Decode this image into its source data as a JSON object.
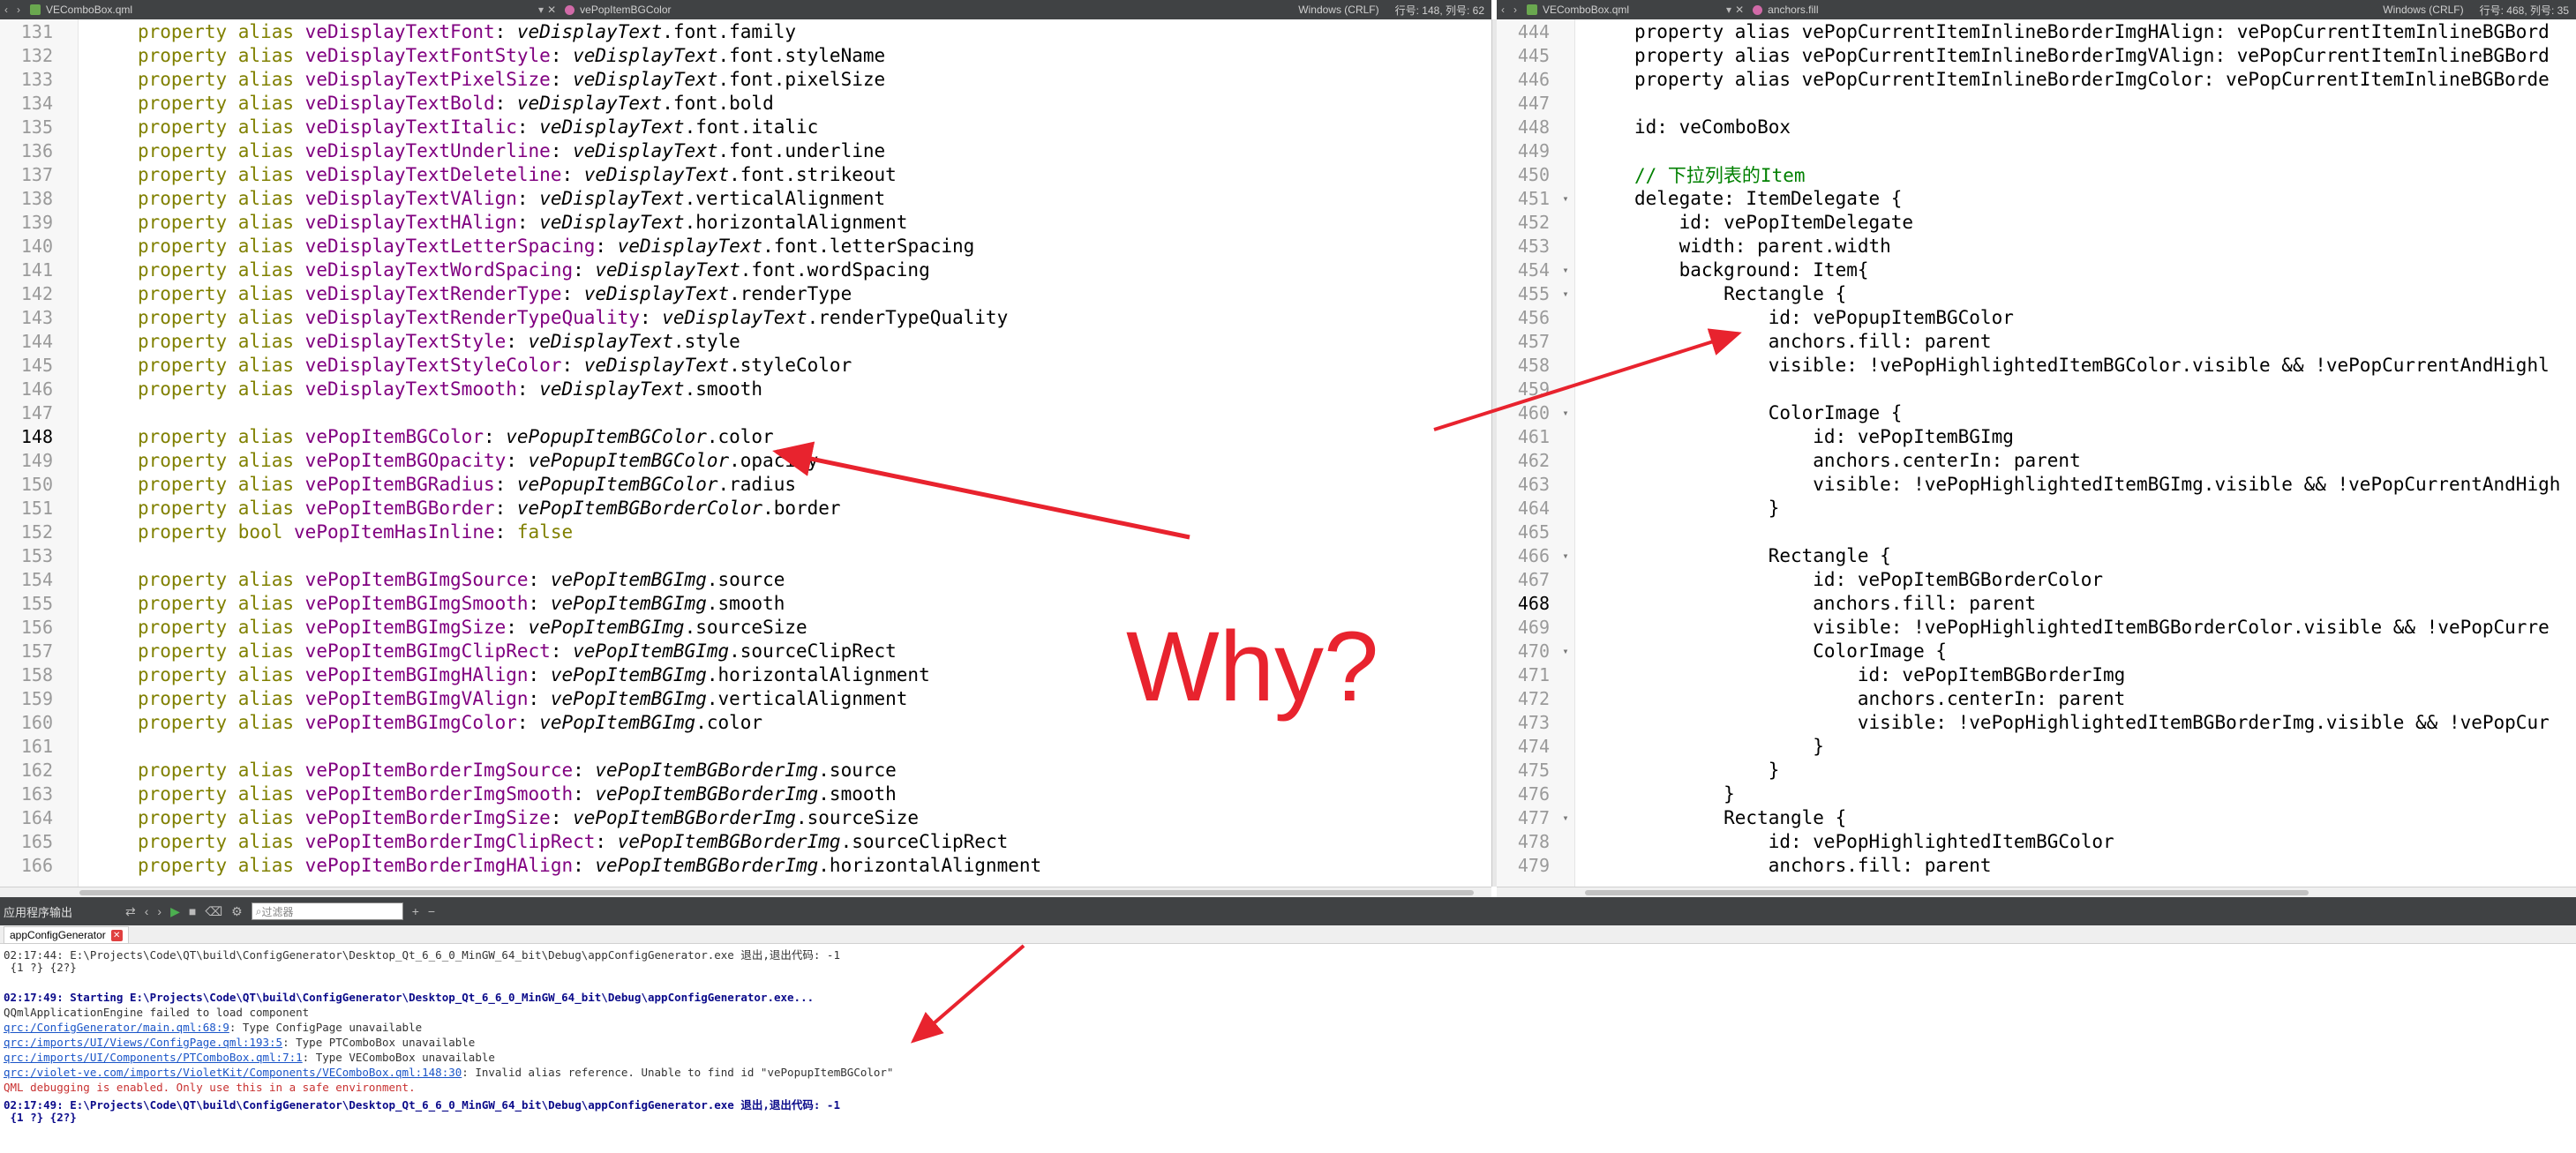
{
  "left_tab": {
    "file": "VEComboBox.qml",
    "symbol": "vePopItemBGColor",
    "encoding": "Windows (CRLF)",
    "position": "行号: 148, 列号: 62"
  },
  "right_tab": {
    "file": "VEComboBox.qml",
    "symbol": "anchors.fill",
    "encoding": "Windows (CRLF)",
    "position": "行号: 468, 列号: 35"
  },
  "left_lines": [
    {
      "n": "131",
      "a": "property alias",
      "b": "veDisplayTextFont",
      "c": "veDisplayText",
      "d": ".font.family"
    },
    {
      "n": "132",
      "a": "property alias",
      "b": "veDisplayTextFontStyle",
      "c": "veDisplayText",
      "d": ".font.styleName"
    },
    {
      "n": "133",
      "a": "property alias",
      "b": "veDisplayTextPixelSize",
      "c": "veDisplayText",
      "d": ".font.pixelSize"
    },
    {
      "n": "134",
      "a": "property alias",
      "b": "veDisplayTextBold",
      "c": "veDisplayText",
      "d": ".font.bold"
    },
    {
      "n": "135",
      "a": "property alias",
      "b": "veDisplayTextItalic",
      "c": "veDisplayText",
      "d": ".font.italic"
    },
    {
      "n": "136",
      "a": "property alias",
      "b": "veDisplayTextUnderline",
      "c": "veDisplayText",
      "d": ".font.underline"
    },
    {
      "n": "137",
      "a": "property alias",
      "b": "veDisplayTextDeleteline",
      "c": "veDisplayText",
      "d": ".font.strikeout"
    },
    {
      "n": "138",
      "a": "property alias",
      "b": "veDisplayTextVAlign",
      "c": "veDisplayText",
      "d": ".verticalAlignment"
    },
    {
      "n": "139",
      "a": "property alias",
      "b": "veDisplayTextHAlign",
      "c": "veDisplayText",
      "d": ".horizontalAlignment"
    },
    {
      "n": "140",
      "a": "property alias",
      "b": "veDisplayTextLetterSpacing",
      "c": "veDisplayText",
      "d": ".font.letterSpacing"
    },
    {
      "n": "141",
      "a": "property alias",
      "b": "veDisplayTextWordSpacing",
      "c": "veDisplayText",
      "d": ".font.wordSpacing"
    },
    {
      "n": "142",
      "a": "property alias",
      "b": "veDisplayTextRenderType",
      "c": "veDisplayText",
      "d": ".renderType"
    },
    {
      "n": "143",
      "a": "property alias",
      "b": "veDisplayTextRenderTypeQuality",
      "c": "veDisplayText",
      "d": ".renderTypeQuality"
    },
    {
      "n": "144",
      "a": "property alias",
      "b": "veDisplayTextStyle",
      "c": "veDisplayText",
      "d": ".style"
    },
    {
      "n": "145",
      "a": "property alias",
      "b": "veDisplayTextStyleColor",
      "c": "veDisplayText",
      "d": ".styleColor"
    },
    {
      "n": "146",
      "a": "property alias",
      "b": "veDisplayTextSmooth",
      "c": "veDisplayText",
      "d": ".smooth"
    },
    {
      "n": "147",
      "a": "",
      "b": "",
      "c": "",
      "d": ""
    },
    {
      "n": "148",
      "a": "property alias",
      "b": "vePopItemBGColor",
      "c": "vePopupItemBGColor",
      "d": ".color",
      "cur": true
    },
    {
      "n": "149",
      "a": "property alias",
      "b": "vePopItemBGOpacity",
      "c": "vePopupItemBGColor",
      "d": ".opacity"
    },
    {
      "n": "150",
      "a": "property alias",
      "b": "vePopItemBGRadius",
      "c": "vePopupItemBGColor",
      "d": ".radius"
    },
    {
      "n": "151",
      "a": "property alias",
      "b": "vePopItemBGBorder",
      "c": "vePopItemBGBorderColor",
      "d": ".border"
    },
    {
      "n": "152",
      "a": "property bool",
      "b": "vePopItemHasInline",
      "c": "",
      "d": "false",
      "plain": true
    },
    {
      "n": "153",
      "a": "",
      "b": "",
      "c": "",
      "d": ""
    },
    {
      "n": "154",
      "a": "property alias",
      "b": "vePopItemBGImgSource",
      "c": "vePopItemBGImg",
      "d": ".source"
    },
    {
      "n": "155",
      "a": "property alias",
      "b": "vePopItemBGImgSmooth",
      "c": "vePopItemBGImg",
      "d": ".smooth"
    },
    {
      "n": "156",
      "a": "property alias",
      "b": "vePopItemBGImgSize",
      "c": "vePopItemBGImg",
      "d": ".sourceSize"
    },
    {
      "n": "157",
      "a": "property alias",
      "b": "vePopItemBGImgClipRect",
      "c": "vePopItemBGImg",
      "d": ".sourceClipRect"
    },
    {
      "n": "158",
      "a": "property alias",
      "b": "vePopItemBGImgHAlign",
      "c": "vePopItemBGImg",
      "d": ".horizontalAlignment"
    },
    {
      "n": "159",
      "a": "property alias",
      "b": "vePopItemBGImgVAlign",
      "c": "vePopItemBGImg",
      "d": ".verticalAlignment"
    },
    {
      "n": "160",
      "a": "property alias",
      "b": "vePopItemBGImgColor",
      "c": "vePopItemBGImg",
      "d": ".color"
    },
    {
      "n": "161",
      "a": "",
      "b": "",
      "c": "",
      "d": ""
    },
    {
      "n": "162",
      "a": "property alias",
      "b": "vePopItemBorderImgSource",
      "c": "vePopItemBGBorderImg",
      "d": ".source"
    },
    {
      "n": "163",
      "a": "property alias",
      "b": "vePopItemBorderImgSmooth",
      "c": "vePopItemBGBorderImg",
      "d": ".smooth"
    },
    {
      "n": "164",
      "a": "property alias",
      "b": "vePopItemBorderImgSize",
      "c": "vePopItemBGBorderImg",
      "d": ".sourceSize"
    },
    {
      "n": "165",
      "a": "property alias",
      "b": "vePopItemBorderImgClipRect",
      "c": "vePopItemBGBorderImg",
      "d": ".sourceClipRect"
    },
    {
      "n": "166",
      "a": "property alias",
      "b": "vePopItemBorderImgHAlign",
      "c": "vePopItemBGBorderImg",
      "d": ".horizontalAlignment"
    }
  ],
  "right_lines": [
    {
      "n": "444",
      "text": "property alias vePopCurrentItemInlineBorderImgHAlign: vePopCurrentItemInlineBGBord"
    },
    {
      "n": "445",
      "text": "property alias vePopCurrentItemInlineBorderImgVAlign: vePopCurrentItemInlineBGBord"
    },
    {
      "n": "446",
      "text": "property alias vePopCurrentItemInlineBorderImgColor: vePopCurrentItemInlineBGBorde"
    },
    {
      "n": "447",
      "text": ""
    },
    {
      "n": "448",
      "text": "id: veComboBox"
    },
    {
      "n": "449",
      "text": ""
    },
    {
      "n": "450",
      "text": "// 下拉列表的Item",
      "comment": true
    },
    {
      "n": "451",
      "text": "delegate: ItemDelegate {",
      "fold": true
    },
    {
      "n": "452",
      "text": "    id: vePopItemDelegate"
    },
    {
      "n": "453",
      "text": "    width: parent.width"
    },
    {
      "n": "454",
      "text": "    background: Item{",
      "fold": true
    },
    {
      "n": "455",
      "text": "        Rectangle {",
      "fold": true
    },
    {
      "n": "456",
      "text": "            id: vePopupItemBGColor"
    },
    {
      "n": "457",
      "text": "            anchors.fill: parent"
    },
    {
      "n": "458",
      "text": "            visible: !vePopHighlightedItemBGColor.visible && !vePopCurrentAndHighl"
    },
    {
      "n": "459",
      "text": ""
    },
    {
      "n": "460",
      "text": "            ColorImage {",
      "fold": true
    },
    {
      "n": "461",
      "text": "                id: vePopItemBGImg"
    },
    {
      "n": "462",
      "text": "                anchors.centerIn: parent"
    },
    {
      "n": "463",
      "text": "                visible: !vePopHighlightedItemBGImg.visible && !vePopCurrentAndHigh"
    },
    {
      "n": "464",
      "text": "            }"
    },
    {
      "n": "465",
      "text": ""
    },
    {
      "n": "466",
      "text": "            Rectangle {",
      "fold": true
    },
    {
      "n": "467",
      "text": "                id: vePopItemBGBorderColor"
    },
    {
      "n": "468",
      "text": "                anchors.fill: parent",
      "cur": true
    },
    {
      "n": "469",
      "text": "                visible: !vePopHighlightedItemBGBorderColor.visible && !vePopCurre"
    },
    {
      "n": "470",
      "text": "                ColorImage {",
      "fold": true
    },
    {
      "n": "471",
      "text": "                    id: vePopItemBGBorderImg"
    },
    {
      "n": "472",
      "text": "                    anchors.centerIn: parent"
    },
    {
      "n": "473",
      "text": "                    visible: !vePopHighlightedItemBGBorderImg.visible && !vePopCur"
    },
    {
      "n": "474",
      "text": "                }"
    },
    {
      "n": "475",
      "text": "            }"
    },
    {
      "n": "476",
      "text": "        }"
    },
    {
      "n": "477",
      "text": "        Rectangle {",
      "fold": true
    },
    {
      "n": "478",
      "text": "            id: vePopHighlightedItemBGColor"
    },
    {
      "n": "479",
      "text": "            anchors.fill: parent"
    }
  ],
  "output_panel": {
    "title": "应用程序输出",
    "filter_placeholder": "过滤器",
    "tab_label": "appConfigGenerator",
    "lines": [
      {
        "cls": "o-norm",
        "text": "02:17:44: E:\\Projects\\Code\\QT\\build\\ConfigGenerator\\Desktop_Qt_6_6_0_MinGW_64_bit\\Debug\\appConfigGenerator.exe 退出,退出代码: -1"
      },
      {
        "cls": "o-norm",
        "text": " {1 ?} {2?}"
      },
      {
        "cls": "o-norm",
        "text": ""
      },
      {
        "cls": "o-bold",
        "text": "02:17:49: Starting E:\\Projects\\Code\\QT\\build\\ConfigGenerator\\Desktop_Qt_6_6_0_MinGW_64_bit\\Debug\\appConfigGenerator.exe..."
      },
      {
        "cls": "o-norm",
        "text": "QQmlApplicationEngine failed to load component"
      },
      {
        "cls": "o-link",
        "text": "qrc:/ConfigGenerator/main.qml:68:9",
        "rest": ": Type ConfigPage unavailable"
      },
      {
        "cls": "o-link",
        "text": "qrc:/imports/UI/Views/ConfigPage.qml:193:5",
        "rest": ": Type PTComboBox unavailable",
        "blur": true
      },
      {
        "cls": "o-link",
        "text": "qrc:/imports/UI/Components/PTComboBox.qml:7:1",
        "rest": ": Type VEComboBox unavailable",
        "blur": true
      },
      {
        "cls": "o-link",
        "text": "qrc:/violet-ve.com/imports/VioletKit/Components/VEComboBox.qml:148:30",
        "rest": ": Invalid alias reference. Unable to find id \"vePopupItemBGColor\""
      },
      {
        "cls": "o-red",
        "text": "QML debugging is enabled. Only use this in a safe environment."
      },
      {
        "cls": "o-bold",
        "text": "02:17:49: E:\\Projects\\Code\\QT\\build\\ConfigGenerator\\Desktop_Qt_6_6_0_MinGW_64_bit\\Debug\\appConfigGenerator.exe 退出,退出代码: -1"
      },
      {
        "cls": "o-bold",
        "text": " {1 ?} {2?}"
      }
    ]
  },
  "annotation": {
    "text": "Why?",
    "color": "#e8232e"
  }
}
